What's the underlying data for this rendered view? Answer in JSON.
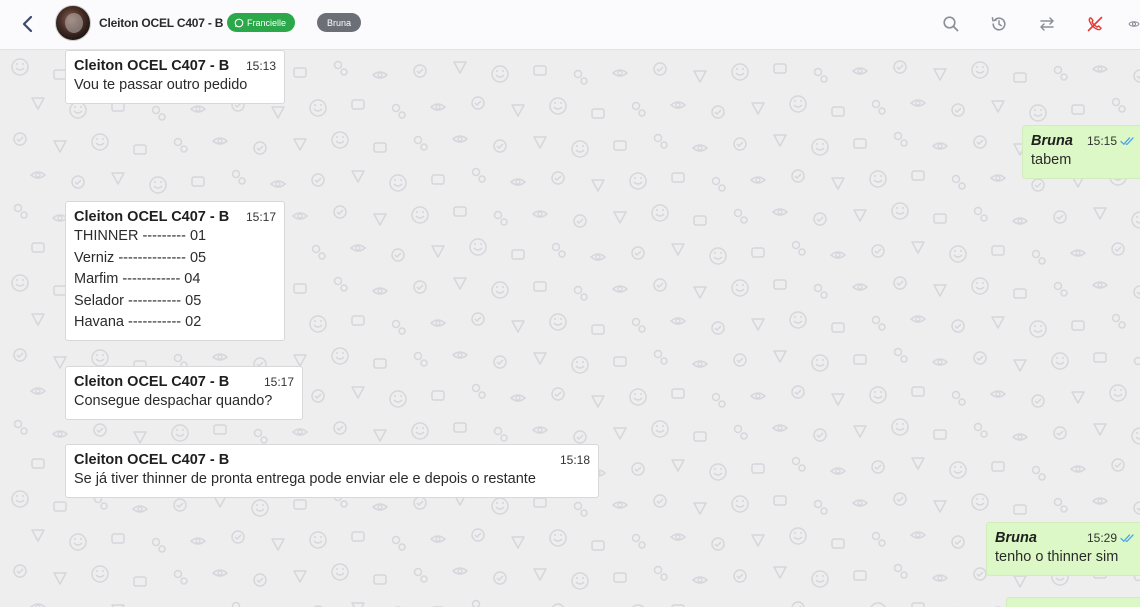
{
  "header": {
    "contact_name": "Cleiton OCEL C407 - B",
    "agent_badge": "Francielle",
    "tag_badge": "Bruna",
    "icons": [
      "back-arrow-icon",
      "search-icon",
      "history-icon",
      "transfer-icon",
      "end-call-icon",
      "view-icon"
    ]
  },
  "colors": {
    "agent_badge_bg": "#2ba84a",
    "tag_badge_bg": "#6b6f78",
    "outgoing_bubble": "#dcf8c6",
    "incoming_bubble": "#ffffff",
    "read_ticks": "#4fa6e8",
    "end_call_icon": "#e53935"
  },
  "messages": [
    {
      "direction": "in",
      "sender": "Cleiton OCEL C407 - B",
      "time": "15:13",
      "lines": [
        "Vou te passar outro pedido"
      ]
    },
    {
      "direction": "out",
      "sender": "Bruna",
      "time": "15:15",
      "status": "read",
      "lines": [
        "tabem"
      ]
    },
    {
      "direction": "in",
      "sender": "Cleiton OCEL C407 - B",
      "time": "15:17",
      "lines": [
        "THINNER --------- 01",
        "Verniz -------------- 05",
        "Marfim ------------ 04",
        "Selador ----------- 05",
        "Havana ----------- 02"
      ]
    },
    {
      "direction": "in",
      "sender": "Cleiton OCEL C407 - B",
      "time": "15:17",
      "lines": [
        "Consegue despachar quando?"
      ]
    },
    {
      "direction": "in",
      "sender": "Cleiton OCEL C407 - B",
      "time": "15:18",
      "lines": [
        "Se já tiver thinner de pronta entrega pode enviar ele e depois o restante"
      ]
    },
    {
      "direction": "out",
      "sender": "Bruna",
      "time": "15:29",
      "status": "read",
      "lines": [
        "tenho o thinner sim"
      ]
    }
  ]
}
